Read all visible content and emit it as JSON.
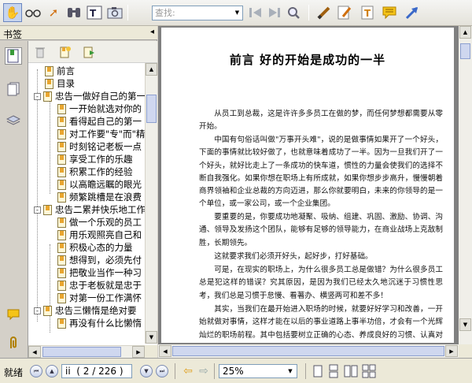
{
  "toolbar": {
    "search_placeholder": "查找:",
    "icons": [
      "hand-icon",
      "glasses-icon",
      "select-arrow-icon",
      "binoculars-icon",
      "text-select-icon",
      "snapshot-icon",
      "search-prev-icon",
      "search-next-icon",
      "search-options-icon",
      "highlight-icon",
      "edit-icon",
      "text-note-icon",
      "comment-icon",
      "arrow-icon"
    ]
  },
  "left_panel": {
    "title": "书签",
    "collapse_glyph": "◂",
    "bookmarks": [
      {
        "label": "前言",
        "level": 1,
        "expander": null
      },
      {
        "label": "目录",
        "level": 1,
        "expander": null
      },
      {
        "label": "忠告一做好自己的第一",
        "level": 1,
        "expander": "-"
      },
      {
        "label": "一开始就选对你的",
        "level": 2,
        "expander": null
      },
      {
        "label": "看得起自己的第一",
        "level": 2,
        "expander": null
      },
      {
        "label": "对工作要\"专\"而\"精",
        "level": 2,
        "expander": null
      },
      {
        "label": "时刻铭记老板一点",
        "level": 2,
        "expander": null
      },
      {
        "label": "享受工作的乐趣",
        "level": 2,
        "expander": null
      },
      {
        "label": "积累工作的经验",
        "level": 2,
        "expander": null
      },
      {
        "label": "以高瞻远瞩的眼光",
        "level": 2,
        "expander": null
      },
      {
        "label": "频繁跳槽是在浪费",
        "level": 2,
        "expander": null
      },
      {
        "label": "忠告二累并快乐地工作",
        "level": 1,
        "expander": "-"
      },
      {
        "label": "做一个乐观的员工",
        "level": 2,
        "expander": null
      },
      {
        "label": "用乐观照亮自己和",
        "level": 2,
        "expander": null
      },
      {
        "label": "积极心态的力量",
        "level": 2,
        "expander": null
      },
      {
        "label": "想得到，必须先付",
        "level": 2,
        "expander": null
      },
      {
        "label": "把敬业当作一种习",
        "level": 2,
        "expander": null
      },
      {
        "label": "忠于老板就是忠于",
        "level": 2,
        "expander": null
      },
      {
        "label": "对第一份工作满怀",
        "level": 2,
        "expander": null
      },
      {
        "label": "忠告三懒惰是绝对要",
        "level": 1,
        "expander": "-"
      },
      {
        "label": "再没有什么比懒惰",
        "level": 2,
        "expander": null
      }
    ]
  },
  "document": {
    "title": "前言  好的开始是成功的一半",
    "paragraphs": [
      "从员工到总裁，这是许许多多员工在做的梦，而任何梦想都需要从零开始。",
      "中国有句俗话叫做\"万事开头难\"，说的是做事情如果开了一个好头，下面的事情就比较好做了，也就意味着成功了一半。因为一旦我们开了一个好头，就好比走上了一条成功的快车道，惯性的力量会使我们的选择不断自我强化。如果你想在职场上有所成就，如果你想步步高升，慢慢朝着商界领袖和企业总裁的方向迈进，那么你就要明白，未来的你领导的是一个单位，或一家公司，或一个企业集团。",
      "要重要的是，你要成功地凝聚、吸纳、组建、巩固、激励、协调、沟通、领导及发扬这个团队，能够有足够的领导能力，在商业战场上克敌制胜，长期领先。",
      "这就要求我们必须开好头，起好步，打好基础。",
      "可是，在现实的职场上，为什么很多员工总是做错？为什么很多员工总是犯这样的错误？究其原因，是因为我们已经太久地沉迷于习惯性思考，我们总是习惯于怠慢、看著办、横竖两可和差不多！",
      "其实，当我们在最开始进入职场的时候，就要好好学习和改善，一开始就做对事情，这样才能在以后的事业道路上事半功倍，才会有一个光辉灿烂的职场前程。其中包括要树立正确的心态、养成良好的习惯、认真对待工作中的每一件事，这样才能获得发展的机遇和成功的事业。"
    ]
  },
  "status_bar": {
    "status": "就绪",
    "page_indicator": "ii  ( 2 / 226 )",
    "zoom": "25%"
  }
}
